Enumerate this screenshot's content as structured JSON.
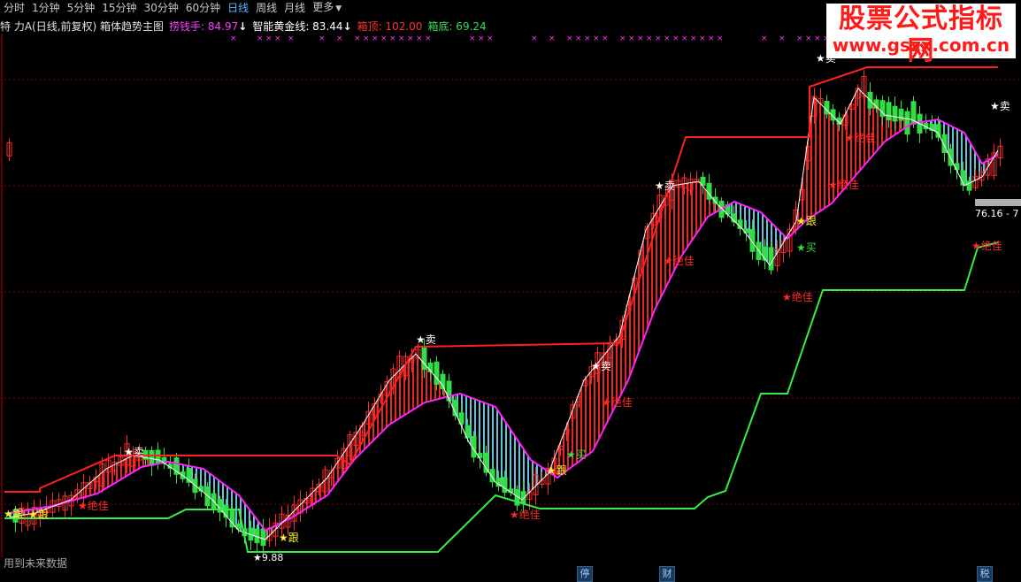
{
  "toolbar": {
    "tabs": [
      {
        "label": "分时",
        "active": false
      },
      {
        "label": "1分钟",
        "active": false
      },
      {
        "label": "5分钟",
        "active": false
      },
      {
        "label": "15分钟",
        "active": false
      },
      {
        "label": "30分钟",
        "active": false
      },
      {
        "label": "60分钟",
        "active": false
      },
      {
        "label": "日线",
        "active": true
      },
      {
        "label": "周线",
        "active": false
      },
      {
        "label": "月线",
        "active": false
      },
      {
        "label": "更多",
        "active": false
      }
    ],
    "more_caret": "▼"
  },
  "indicator_bar": {
    "stock": "特 力A(日线,前复权) 箱体趋势主图",
    "money_label": "捞钱手: 84.97",
    "golden_label": "智能黄金线: 83.44",
    "box_top": "箱顶: 102.00",
    "box_bottom": "箱底: 69.24",
    "arrow_down": "↓"
  },
  "watermark": {
    "title": "股票公式指标网",
    "url": "www.gszx.com.cn"
  },
  "footer": {
    "note": "用到未来数据",
    "badges": [
      "停",
      "财",
      "税"
    ]
  },
  "price_tag": "76.16 - 7",
  "signals": {
    "buy": "买",
    "sell": "卖",
    "follow": "跟",
    "best": "绝佳",
    "low_value": "9.88"
  },
  "colors": {
    "background": "#000000",
    "up_candle": "#ff2a2a",
    "down_candle": "#33dd44",
    "golden_line": "#ff22ff",
    "box_line": "#ff2020",
    "support_line": "#33ee44",
    "fill_rising": "#ff2a2a",
    "fill_falling": "#6fd8f0",
    "grid": "#8a0000"
  }
}
